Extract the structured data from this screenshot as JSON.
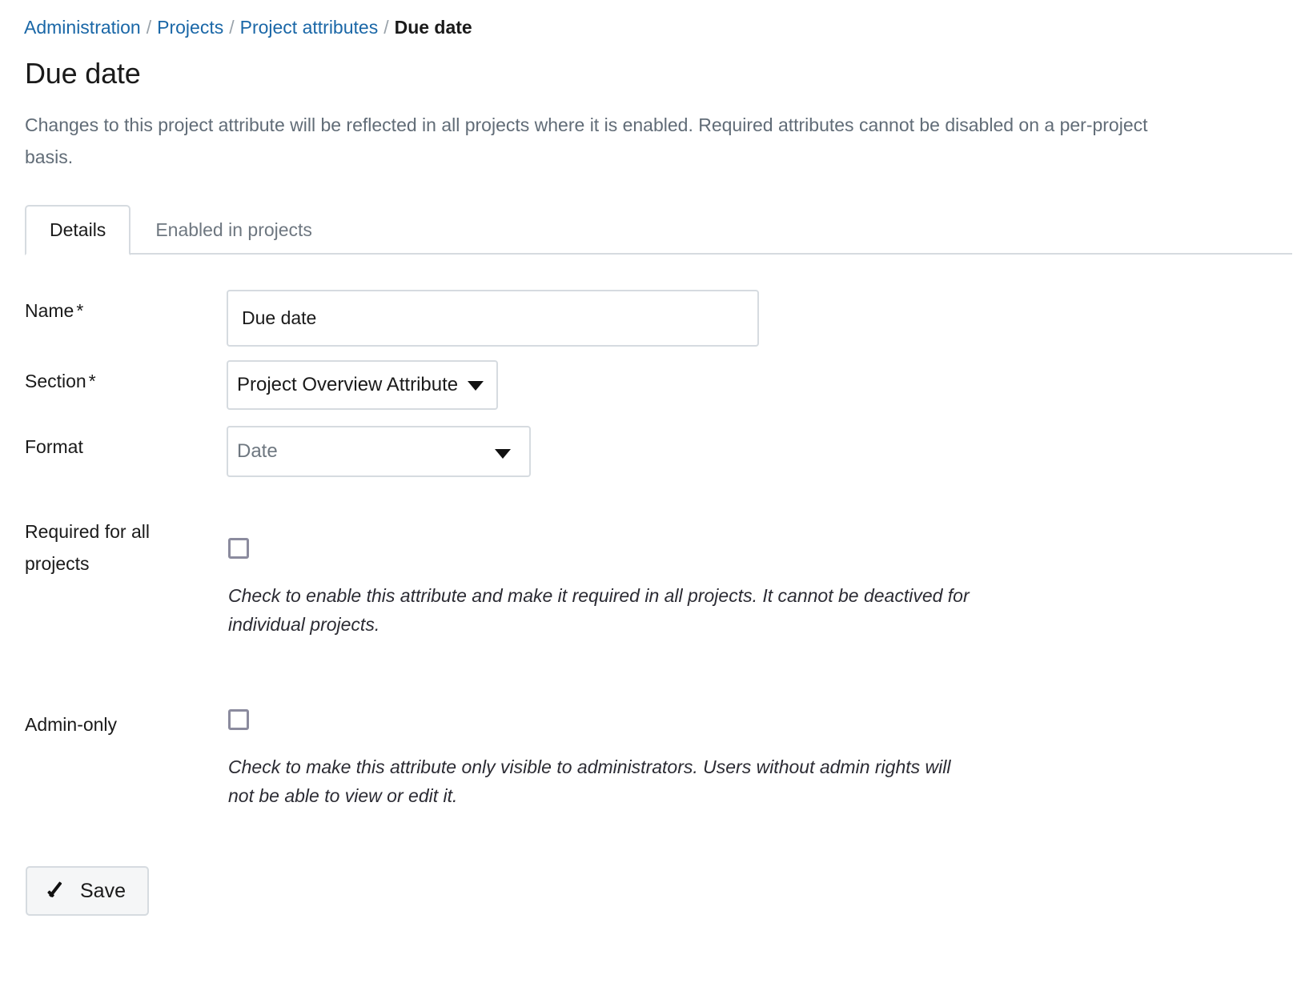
{
  "breadcrumb": {
    "separator": "/",
    "items": [
      {
        "label": "Administration",
        "link": true
      },
      {
        "label": "Projects",
        "link": true
      },
      {
        "label": "Project attributes",
        "link": true
      },
      {
        "label": "Due date",
        "link": false
      }
    ]
  },
  "header": {
    "title": "Due date",
    "description": "Changes to this project attribute will be reflected in all projects where it is enabled. Required attributes cannot be disabled on a per-project basis."
  },
  "tabs": [
    {
      "label": "Details",
      "active": true
    },
    {
      "label": "Enabled in projects",
      "active": false
    }
  ],
  "form": {
    "name": {
      "label": "Name",
      "required_marker": "*",
      "value": "Due date",
      "placeholder": ""
    },
    "section": {
      "label": "Section",
      "required_marker": "*",
      "value": "Project Overview Attribute",
      "caret_icon": "chevron-down-icon"
    },
    "format": {
      "label": "Format",
      "required_marker": "",
      "value": "Date",
      "caret_icon": "chevron-down-icon"
    },
    "required_for_all_projects": {
      "label": "Required for all projects",
      "checked": false,
      "help": "Check to enable this attribute and make it required in all projects. It cannot be deactived for individual projects."
    },
    "admin_only": {
      "label": "Admin-only",
      "checked": false,
      "help": "Check to make this attribute only visible to administrators. Users without admin rights will not be able to view or edit it."
    },
    "save_button": {
      "label": "Save",
      "icon": "check-icon"
    }
  },
  "colors": {
    "link": "#1a67a7",
    "text": "#1a1a1a",
    "muted": "#616c77",
    "border": "#d6dbe0",
    "checkbox_border": "#8b8b9e",
    "button_bg": "#f5f6f7"
  }
}
